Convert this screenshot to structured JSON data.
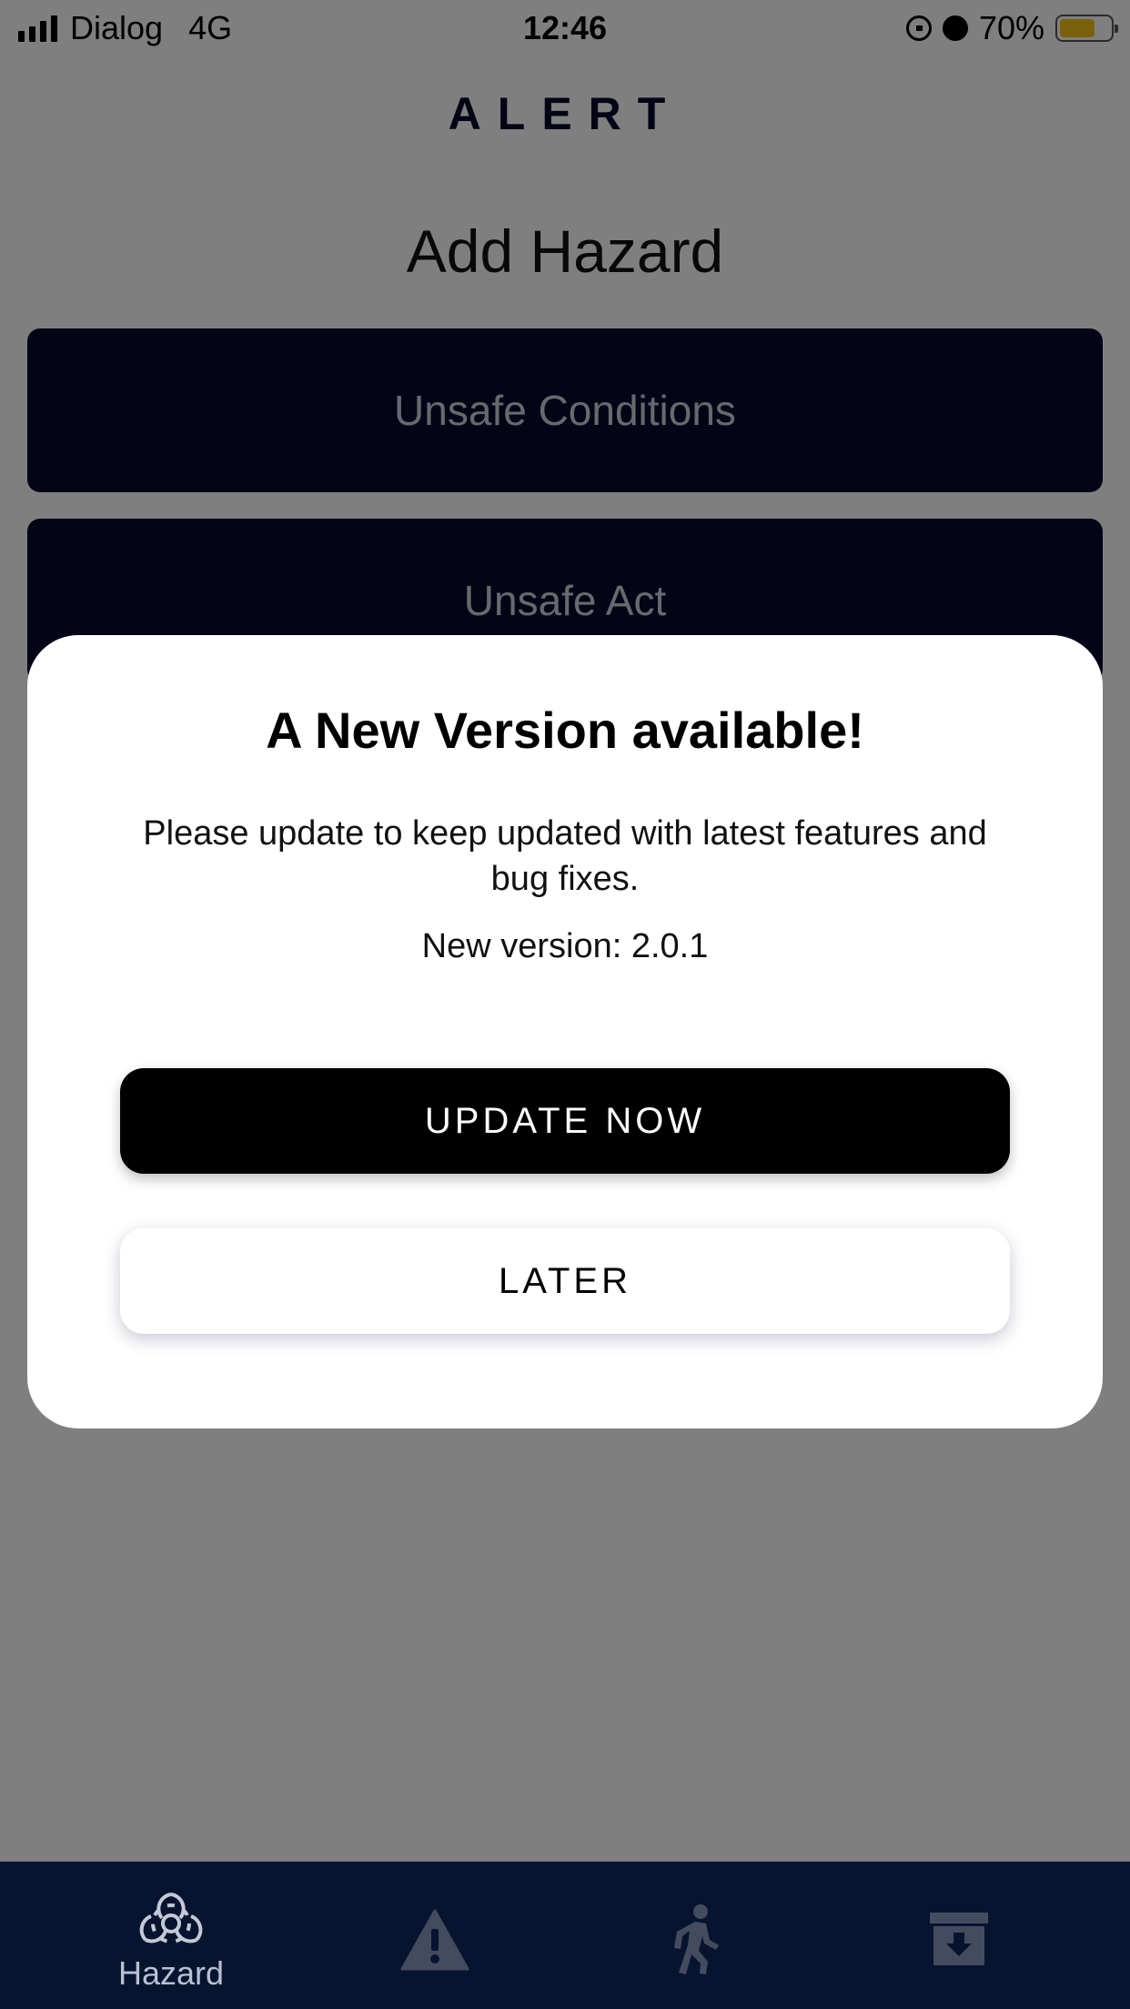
{
  "status_bar": {
    "carrier": "Dialog",
    "network": "4G",
    "time": "12:46",
    "battery": "70%",
    "battery_level": 0.7,
    "icons": [
      "signal-icon",
      "orientation-lock-icon",
      "alarm-icon",
      "battery-icon"
    ]
  },
  "header": {
    "app_title": "ALERT"
  },
  "main": {
    "title": "Add Hazard",
    "options": [
      {
        "label": "Unsafe Conditions"
      },
      {
        "label": "Unsafe Act"
      }
    ]
  },
  "modal": {
    "title": "A New Version available!",
    "message": "Please update to keep updated with latest features and bug fixes.",
    "version_text": "New version: 2.0.1",
    "update_label": "UPDATE NOW",
    "later_label": "LATER"
  },
  "tab_bar": {
    "tabs": [
      {
        "label": "Hazard",
        "icon": "biohazard-icon",
        "active": true
      },
      {
        "label": "",
        "icon": "warning-icon",
        "active": false
      },
      {
        "label": "",
        "icon": "walking-person-icon",
        "active": false
      },
      {
        "label": "",
        "icon": "archive-download-icon",
        "active": false
      }
    ]
  },
  "colors": {
    "primary_navy": "#060a2e",
    "tab_bar_bg": "#071430",
    "battery_fill": "#f5c51b"
  }
}
